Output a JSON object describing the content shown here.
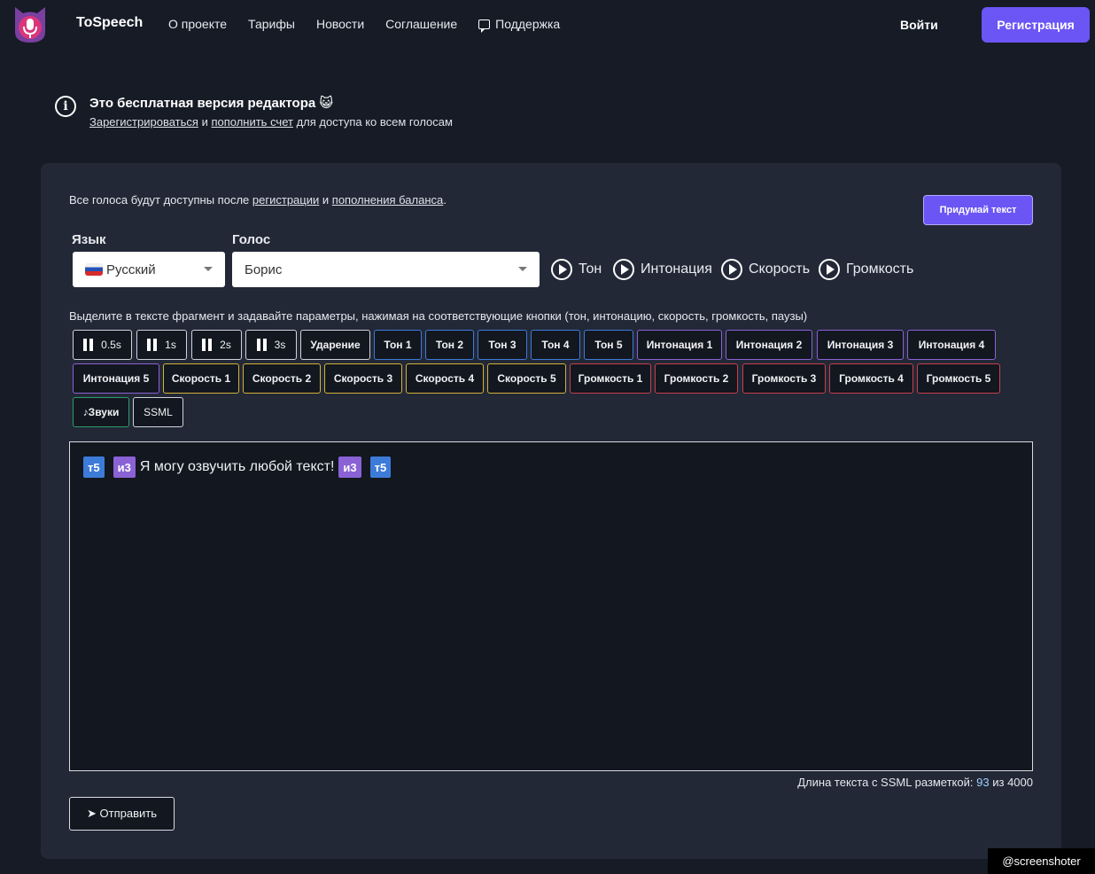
{
  "header": {
    "brand": "ToSpeech",
    "nav": [
      "О проекте",
      "Тарифы",
      "Новости",
      "Соглашение",
      "Поддержка"
    ],
    "login": "Войти",
    "register": "Регистрация"
  },
  "notice": {
    "title": "Это бесплатная версия редактора",
    "emoji": "😺",
    "link_register": "Зарегистрироваться",
    "and": "и",
    "link_topup": "пополнить счет",
    "rest": "для доступа ко всем голосам"
  },
  "panel": {
    "hint_prefix": "Все голоса будут доступны после",
    "hint_link1": "регистрации",
    "hint_and": "и",
    "hint_link2": "пополнения баланса",
    "hint_suffix": ".",
    "suggest_button": "Придумай текст",
    "language_label": "Язык",
    "language_value": "Русский",
    "voice_label": "Голос",
    "voice_value": "Борис",
    "play_controls": [
      "Тон",
      "Интонация",
      "Скорость",
      "Громкость"
    ],
    "instructions": "Выделите в тексте фрагмент и задавайте параметры, нажимая на соответствующие кнопки (тон, интонацию, скорость, громкость, паузы)",
    "buttons_row1": [
      "0.5s",
      "1s",
      "2s",
      "3s",
      "Ударение",
      "Тон 1",
      "Тон 2",
      "Тон 3",
      "Тон 4",
      "Тон 5",
      "Интонация 1",
      "Интонация 2",
      "Интонация 3",
      "Интонация 4"
    ],
    "buttons_row2": [
      "Интонация 5",
      "Скорость 1",
      "Скорость 2",
      "Скорость 3",
      "Скорость 4",
      "Скорость 5",
      "Громкость 1",
      "Громкость 2",
      "Громкость 3",
      "Громкость 4",
      "Громкость 5"
    ],
    "buttons_row3": [
      "♪Звуки",
      "SSML"
    ],
    "editor": {
      "tag_open_tone": "т5",
      "tag_open_int": "и3",
      "text": "Я могу озвучить любой текст!",
      "tag_close_int": "и3",
      "tag_close_tone": "т5"
    },
    "count_label": "Длина текста с SSML разметкой:",
    "count_value": "93",
    "count_of": "из",
    "count_max": "4000",
    "send_button": "➤ Отправить"
  },
  "watermark": "@screenshoter",
  "colors": {
    "accent": "#6c55f5",
    "ton": "#3d7bd9",
    "intonation": "#8a62d6",
    "speed": "#d2b23a",
    "volume": "#c8404c",
    "sounds": "#2e9c6c"
  }
}
